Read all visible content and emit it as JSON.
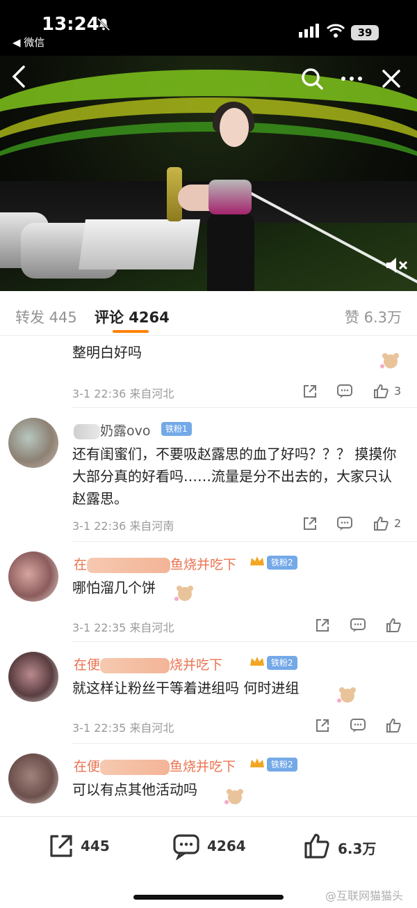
{
  "status_bar": {
    "time": "13:24",
    "back_app": "◀ 微信",
    "battery": "39",
    "icons": [
      "bell-slash-icon",
      "signal-icon",
      "wifi-icon",
      "battery-icon"
    ]
  },
  "video": {
    "icons": [
      "back-arrow-icon",
      "search-icon",
      "more-icon",
      "close-icon",
      "mute-icon"
    ]
  },
  "tabs": {
    "repost": "转发 445",
    "comment": "评论 4264",
    "like": "赞 6.3万",
    "accent": "#ff8200"
  },
  "comments": [
    {
      "text": "整明白好吗",
      "meta": "3-1 22:36 来自河北",
      "likes": "3"
    },
    {
      "username": "奶露ovo",
      "badge": "铁粉1",
      "text": "还有闺蜜们，不要吸赵露思的血了好吗？？？ 摸摸你大部分真的好看吗……流量是分不出去的，大家只认赵露思。",
      "meta": "3-1 22:36 来自河南",
      "likes": "2"
    },
    {
      "username_prefix": "在",
      "username_suffix": "鱼烧并吃下",
      "badge": "铁粉2",
      "text": "哪怕溜几个饼",
      "meta": "3-1 22:35 来自河北"
    },
    {
      "username_prefix": "在便",
      "username_suffix": "烧并吃下",
      "badge": "铁粉2",
      "text": "就这样让粉丝干等着进组吗 何时进组",
      "meta": "3-1 22:35 来自河北"
    },
    {
      "username_prefix": "在便",
      "username_suffix": "鱼烧并吃下",
      "badge": "铁粉2",
      "text": "可以有点其他活动吗"
    }
  ],
  "bottom_bar": {
    "repost_count": "445",
    "comment_count": "4264",
    "like_count": "6.3万",
    "watermark": "@互联网猫猫头"
  }
}
